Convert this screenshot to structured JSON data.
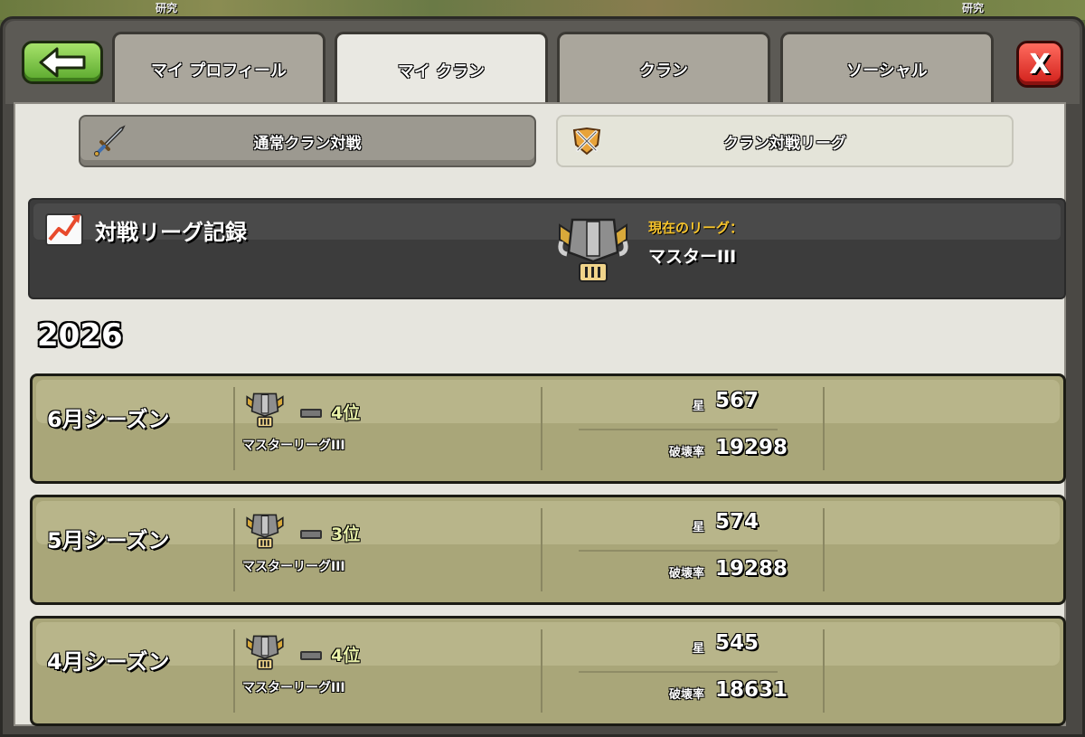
{
  "background": {
    "left_label": "研究",
    "right_label": "研究"
  },
  "nav": {
    "back_icon": "arrow-left-icon",
    "close_label": "X",
    "tabs": [
      {
        "label": "マイ プロフィール",
        "active": false
      },
      {
        "label": "マイ クラン",
        "active": true
      },
      {
        "label": "クラン",
        "active": false
      },
      {
        "label": "ソーシャル",
        "active": false
      }
    ]
  },
  "subtabs": {
    "normal_war": {
      "label": "通常クラン対戦",
      "icon": "sword-icon",
      "active": false
    },
    "war_league": {
      "label": "クラン対戦リーグ",
      "icon": "crossed-swords-icon",
      "active": true
    }
  },
  "league_header": {
    "title": "対戦リーグ記録",
    "current_label": "現在のリーグ：",
    "current_value": "マスターIII"
  },
  "year": "2026",
  "seasons": [
    {
      "name": "6月シーズン",
      "rank": "4位",
      "league": "マスターリーグIII",
      "stars_label": "星",
      "stars": "567",
      "destruction_label": "破壊率",
      "destruction": "19298"
    },
    {
      "name": "5月シーズン",
      "rank": "3位",
      "league": "マスターリーグIII",
      "stars_label": "星",
      "stars": "574",
      "destruction_label": "破壊率",
      "destruction": "19288"
    },
    {
      "name": "4月シーズン",
      "rank": "4位",
      "league": "マスターリーグIII",
      "stars_label": "星",
      "stars": "545",
      "destruction_label": "破壊率",
      "destruction": "18631"
    }
  ],
  "colors": {
    "accent_gold": "#f7c42c",
    "back_green": "#5aa82d",
    "close_red": "#d01f1a",
    "card_olive": "#a9a679"
  }
}
